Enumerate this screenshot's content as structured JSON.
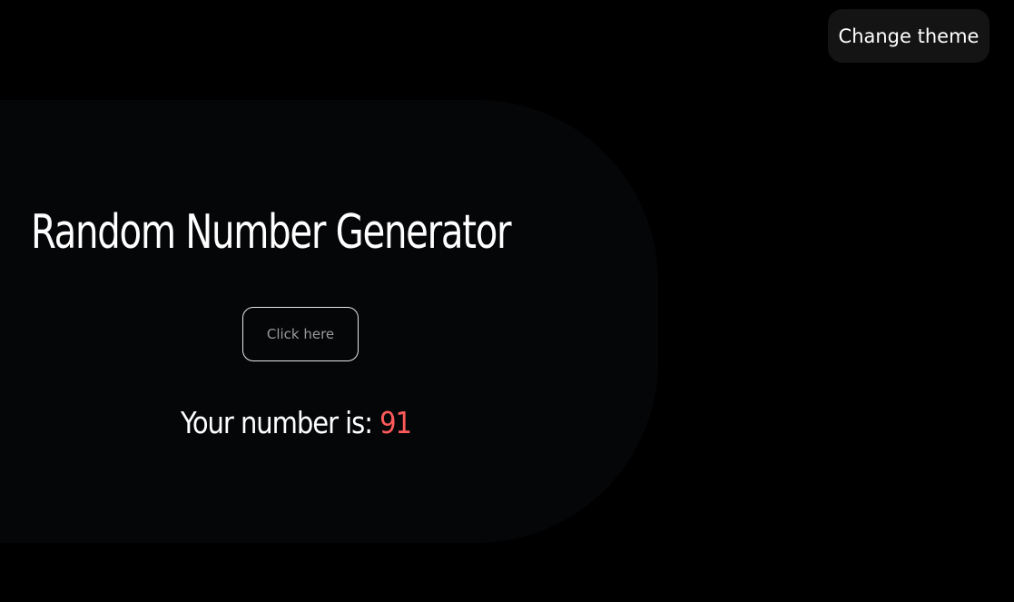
{
  "header": {
    "theme_button_label": "Change theme"
  },
  "main": {
    "title": "Random Number Generator",
    "action_button_label": "Click here",
    "result_label": "Your number is: ",
    "result_value": "91"
  },
  "colors": {
    "page_background": "#000000",
    "card_background": "#050608",
    "accent_number": "#ff5a5a",
    "theme_button_background": "#141414",
    "text": "#ffffff"
  }
}
